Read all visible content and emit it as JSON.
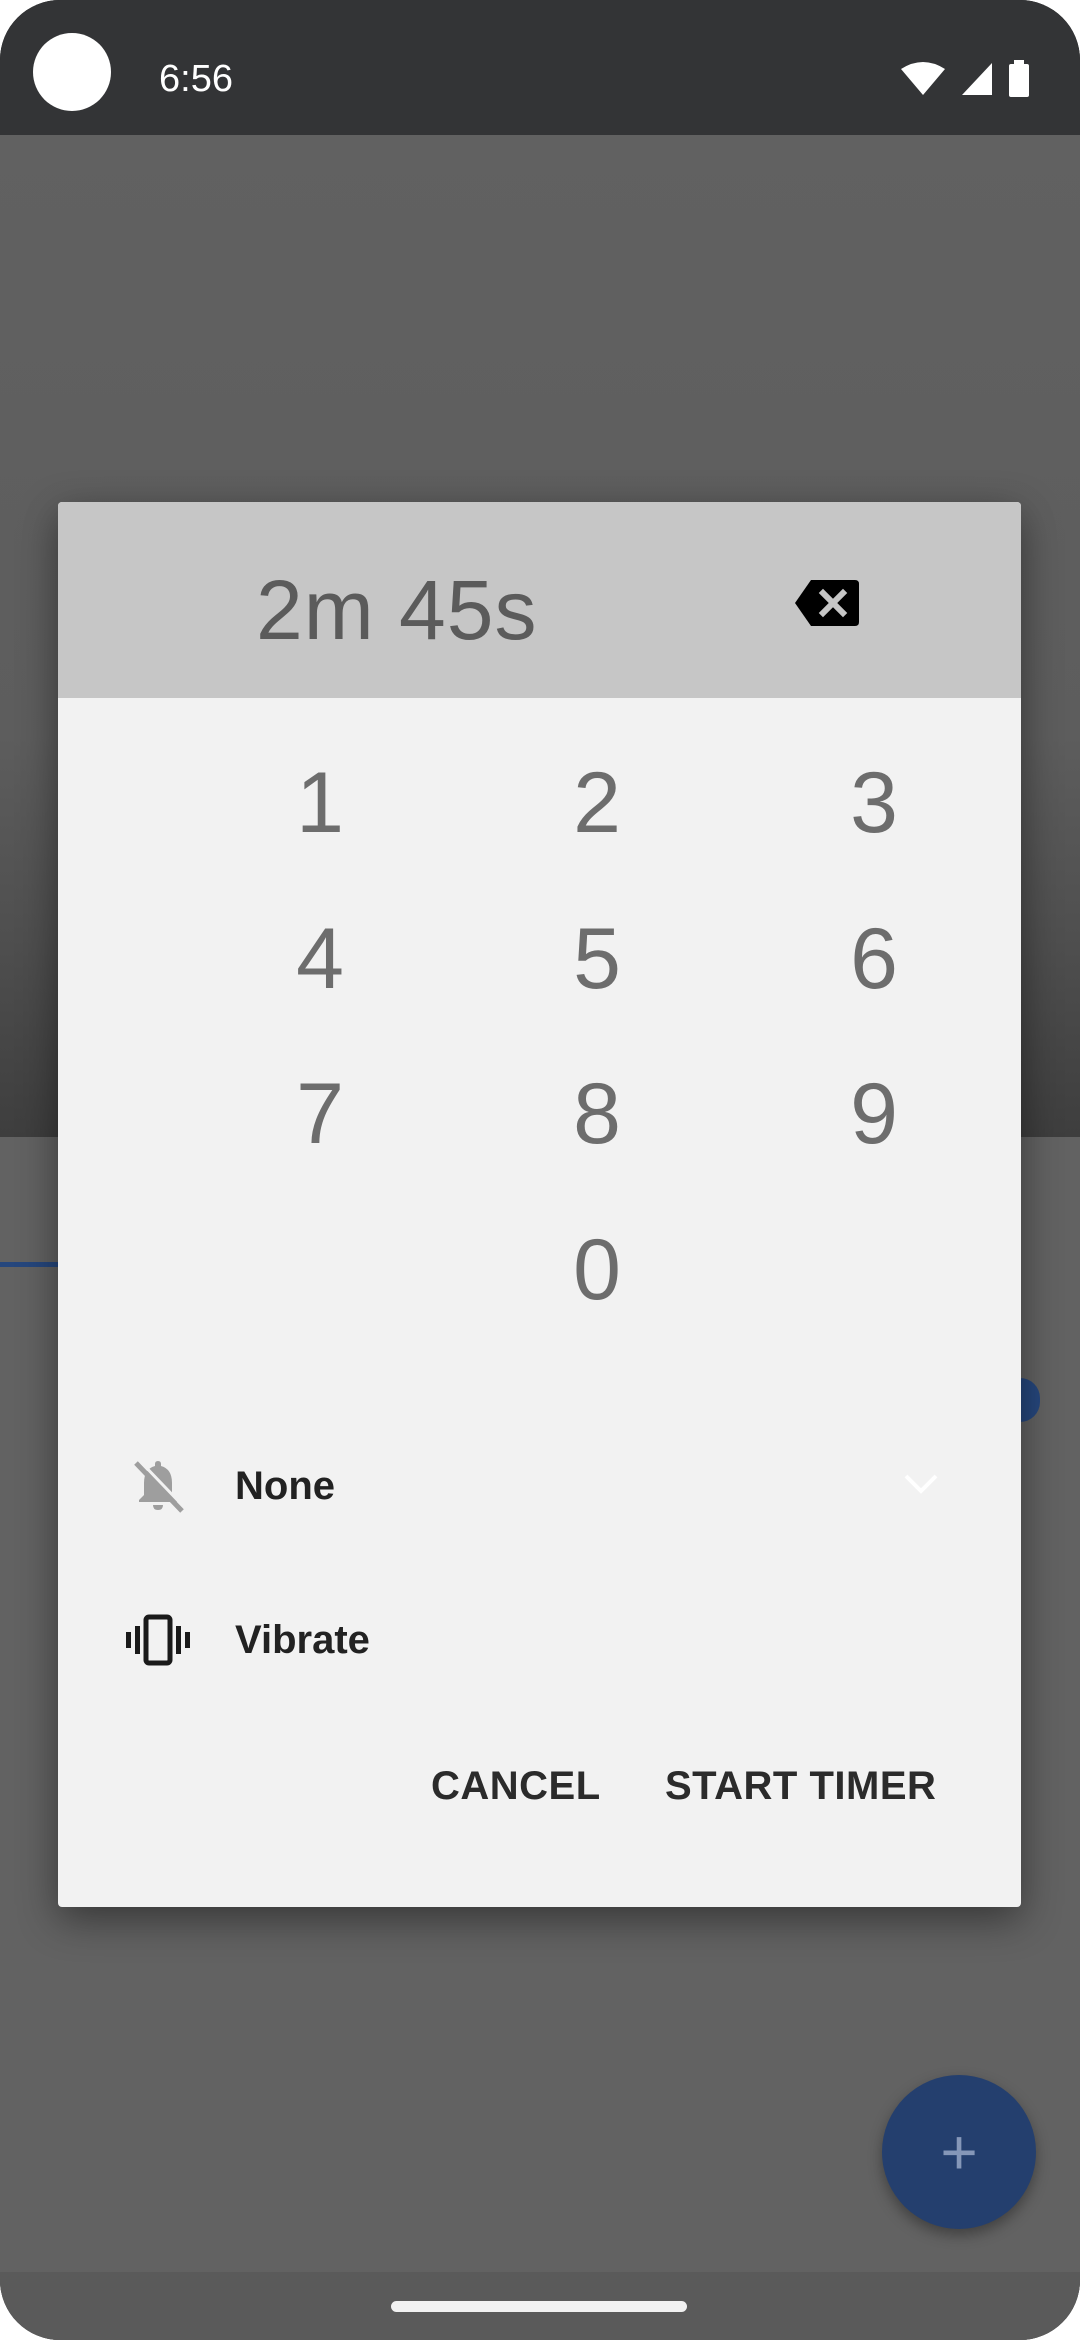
{
  "status_bar": {
    "time": "6:56",
    "icons": [
      "wifi-icon",
      "cell-signal-icon",
      "battery-icon"
    ]
  },
  "dialog": {
    "display": "2m 45s",
    "backspace_icon": "backspace-icon",
    "keys": [
      "1",
      "2",
      "3",
      "4",
      "5",
      "6",
      "7",
      "8",
      "9",
      "0"
    ],
    "ringtone": {
      "icon": "notifications-off-icon",
      "label": "None"
    },
    "vibrate": {
      "icon": "vibrate-icon",
      "label": "Vibrate"
    },
    "actions": {
      "cancel": "CANCEL",
      "start": "START TIMER"
    }
  },
  "fab": {
    "icon": "plus-icon",
    "label": "+"
  },
  "colors": {
    "accent": "#26477d",
    "dialog_bg": "#f2f2f2",
    "header_bg": "#c6c6c6",
    "status_bar": "#333436"
  }
}
